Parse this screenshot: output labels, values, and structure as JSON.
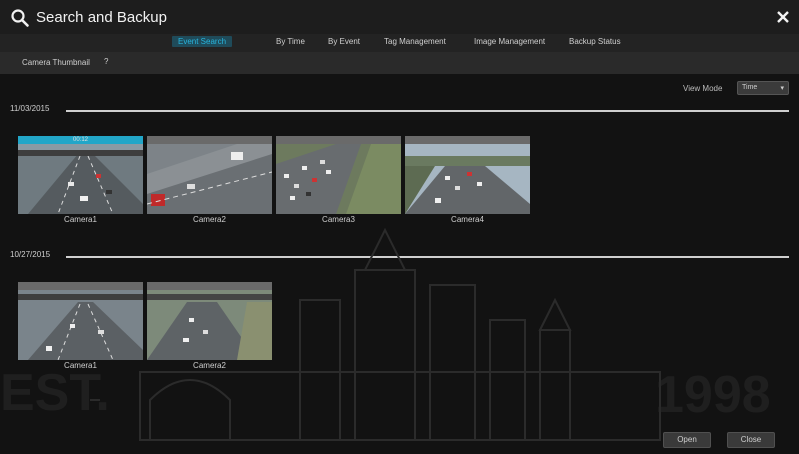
{
  "window": {
    "title": "Search and Backup"
  },
  "tabs": [
    {
      "label": "Event Search",
      "active": true
    },
    {
      "label": "By Time",
      "active": false
    },
    {
      "label": "By Event",
      "active": false
    },
    {
      "label": "Tag Management",
      "active": false
    },
    {
      "label": "Image Management",
      "active": false
    },
    {
      "label": "Backup Status",
      "active": false
    }
  ],
  "subtab": {
    "label": "Camera Thumbnail",
    "arrow": "?"
  },
  "view_mode": {
    "label": "View Mode",
    "value": "Time"
  },
  "groups": [
    {
      "date": "11/03/2015",
      "cameras": [
        {
          "name": "Camera1",
          "header": "00:12",
          "selected": true
        },
        {
          "name": "Camera2",
          "header": "",
          "selected": false
        },
        {
          "name": "Camera3",
          "header": "",
          "selected": false
        },
        {
          "name": "Camera4",
          "header": "",
          "selected": false
        }
      ]
    },
    {
      "date": "10/27/2015",
      "cameras": [
        {
          "name": "Camera1",
          "header": "",
          "selected": false
        },
        {
          "name": "Camera2",
          "header": "",
          "selected": false
        }
      ]
    }
  ],
  "buttons": {
    "open": "Open",
    "close": "Close"
  },
  "watermark": {
    "year": "1998",
    "est": "EST."
  },
  "colors": {
    "accent": "#22a6c8",
    "background": "#121212"
  }
}
